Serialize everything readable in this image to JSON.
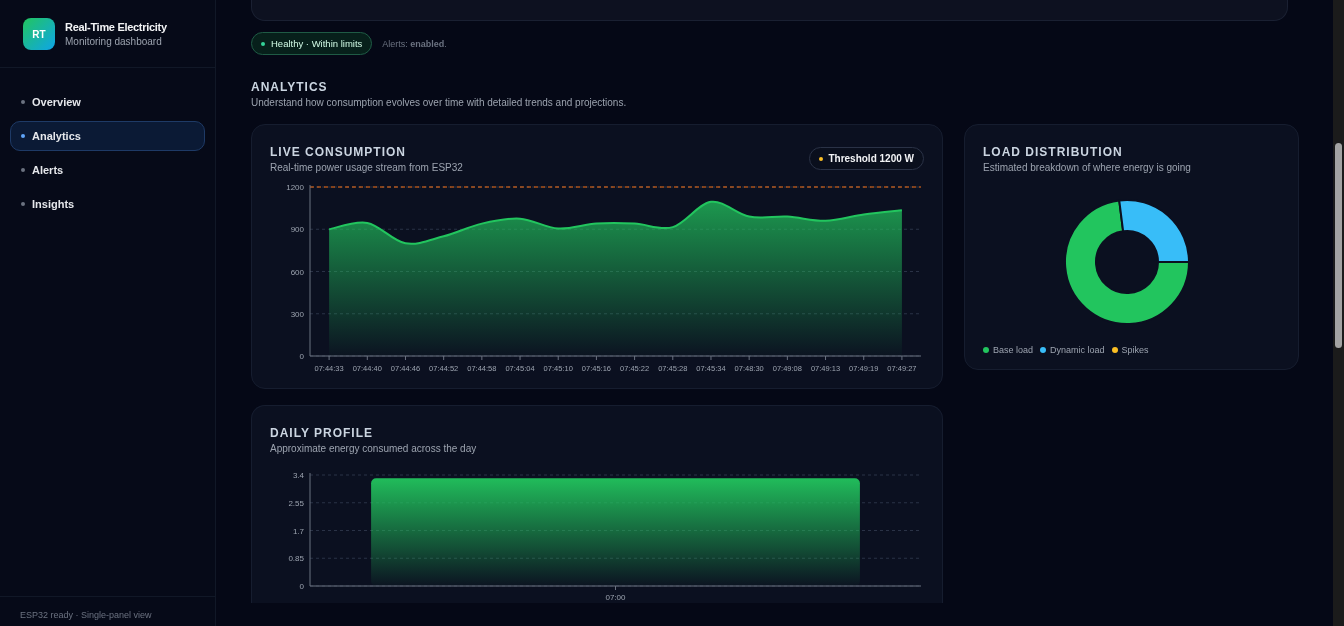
{
  "sidebar": {
    "logo": "RT",
    "app_title": "Real-Time Electricity",
    "app_subtitle": "Monitoring dashboard",
    "items": [
      {
        "label": "Overview",
        "selected": false
      },
      {
        "label": "Analytics",
        "selected": true
      },
      {
        "label": "Alerts",
        "selected": false
      },
      {
        "label": "Insights",
        "selected": false
      }
    ],
    "footer": "ESP32 ready · Single-panel view"
  },
  "status": {
    "pill": "Healthy · Within limits",
    "alerts": "Alerts: **enabled**."
  },
  "section": {
    "title": "ANALYTICS",
    "subtitle": "Understand how consumption evolves over time with detailed trends and projections."
  },
  "live_card": {
    "title": "LIVE CONSUMPTION",
    "subtitle": "Real-time power usage stream from ESP32",
    "badge": "Threshold 1200 W",
    "chart_data": {
      "type": "line",
      "categories": [
        "07:44:33",
        "07:44:40",
        "07:44:46",
        "07:44:52",
        "07:44:58",
        "07:45:04",
        "07:45:10",
        "07:45:16",
        "07:45:22",
        "07:45:28",
        "07:45:34",
        "07:48:30",
        "07:49:08",
        "07:49:13",
        "07:49:19",
        "07:49:27"
      ],
      "values": [
        900,
        945,
        800,
        850,
        940,
        975,
        905,
        940,
        940,
        915,
        1095,
        990,
        990,
        960,
        1005,
        1035
      ],
      "ylim": [
        0,
        1200
      ],
      "yticks": [
        0,
        300,
        600,
        900,
        1200
      ],
      "grid": true
    }
  },
  "load_card": {
    "title": "LOAD DISTRIBUTION",
    "subtitle": "Estimated breakdown of where energy is going",
    "chart_data": {
      "type": "donut",
      "categories": [
        "Base load",
        "Dynamic load",
        "Spikes"
      ],
      "values": [
        73,
        27,
        0
      ],
      "colors": [
        "#22c55e",
        "#38bdf8",
        "#fbbf24"
      ],
      "legend": "bottom"
    }
  },
  "daily_card": {
    "title": "DAILY PROFILE",
    "subtitle": "Approximate energy consumed across the day",
    "chart_data": {
      "type": "bar",
      "categories": [
        "07:00"
      ],
      "values": [
        3.3
      ],
      "ylim": [
        0,
        3.4
      ],
      "grid": true,
      "yticks": [
        {
          "value": 0,
          "label": "0"
        },
        {
          "value": 0.85,
          "label": "0.85"
        },
        {
          "value": 1.7,
          "label": "1.7"
        },
        {
          "value": 2.55,
          "label": "2.55"
        },
        {
          "value": 3.4,
          "label": "3.4"
        }
      ]
    }
  }
}
